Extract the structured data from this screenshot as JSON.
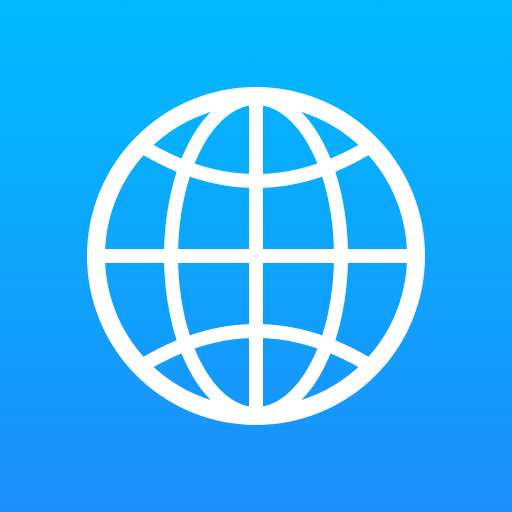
{
  "icon": {
    "name": "globe-icon",
    "background_top": "#00BBFF",
    "background_bottom": "#1C8EFA",
    "glyph_color": "#FFFFFF"
  }
}
